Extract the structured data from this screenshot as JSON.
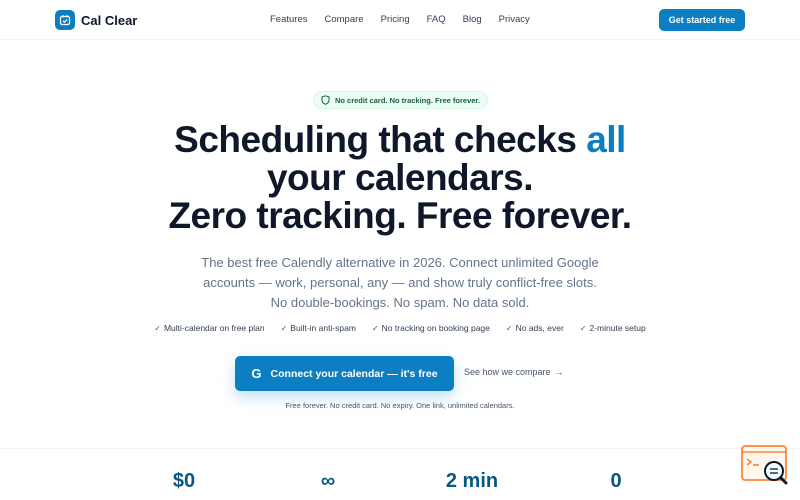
{
  "brand": {
    "name": "Cal Clear",
    "color": "#0b7fc2"
  },
  "nav": {
    "links": [
      "Features",
      "Compare",
      "Pricing",
      "FAQ",
      "Blog",
      "Privacy"
    ],
    "cta": "Get started free"
  },
  "hero": {
    "badge": "No credit card. No tracking. Free forever.",
    "headline_pre": "Scheduling that checks ",
    "headline_accent": "all",
    "headline_line2": "your calendars.",
    "headline_line3": "Zero tracking. Free forever.",
    "sub_line1": "The best free Calendly alternative in 2026. Connect unlimited Google",
    "sub_line2": "accounts — work, personal, any — and show truly conflict-free slots.",
    "sub_line3": "No double-bookings. No spam. No data sold.",
    "features": [
      "Multi-calendar on free plan",
      "Built-in anti-spam",
      "No tracking on booking page",
      "No ads, ever",
      "2-minute setup"
    ],
    "cta_main": "Connect your calendar — it's free",
    "cta_icon": "google-g-icon",
    "secondary_link": "See how we compare",
    "fine_print": "Free forever. No credit card. No expiry. One link, unlimited calendars."
  },
  "stats": [
    {
      "value": "$0"
    },
    {
      "value": "∞"
    },
    {
      "value": "2 min"
    },
    {
      "value": "0"
    }
  ],
  "colors": {
    "accent": "#0b7fc2",
    "heading": "#0f172a",
    "body": "#64748b",
    "badge_bg": "#ecfdf5",
    "badge_text": "#166534",
    "stat_text": "#075985"
  }
}
